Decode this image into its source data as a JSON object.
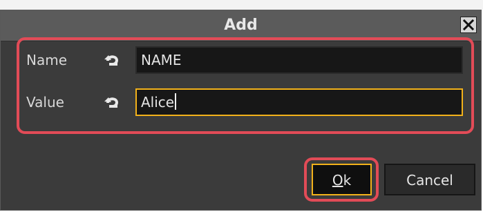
{
  "dialog": {
    "title": "Add",
    "close_icon": "close-icon"
  },
  "fields": {
    "name": {
      "label": "Name",
      "value": "NAME",
      "reset_icon": "reset-arrow-icon"
    },
    "value": {
      "label": "Value",
      "value": "Alice",
      "reset_icon": "reset-arrow-icon"
    }
  },
  "buttons": {
    "ok_label_underlined": "O",
    "ok_label_rest": "k",
    "cancel_label": "Cancel"
  },
  "colors": {
    "accent_focus": "#f3b21a",
    "highlight": "#e24b57",
    "dialog_bg": "#3b3b3b"
  }
}
